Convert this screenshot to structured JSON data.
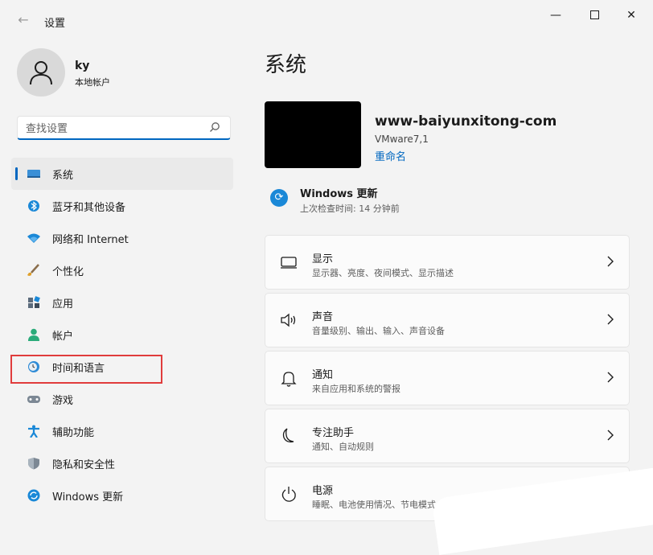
{
  "titlebar": {
    "app_title": "设置",
    "back_glyph": "←",
    "min_glyph": "—",
    "close_glyph": "✕"
  },
  "user": {
    "name": "ky",
    "account_type": "本地帐户"
  },
  "search": {
    "placeholder": "查找设置"
  },
  "sidebar": {
    "items": [
      {
        "label": "系统",
        "icon": "system-display-icon",
        "active": true
      },
      {
        "label": "蓝牙和其他设备",
        "icon": "bluetooth-icon"
      },
      {
        "label": "网络和 Internet",
        "icon": "wifi-icon"
      },
      {
        "label": "个性化",
        "icon": "brush-icon"
      },
      {
        "label": "应用",
        "icon": "apps-icon"
      },
      {
        "label": "帐户",
        "icon": "account-icon"
      },
      {
        "label": "时间和语言",
        "icon": "time-language-icon",
        "highlighted": true
      },
      {
        "label": "游戏",
        "icon": "gamepad-icon"
      },
      {
        "label": "辅助功能",
        "icon": "accessibility-icon"
      },
      {
        "label": "隐私和安全性",
        "icon": "shield-icon"
      },
      {
        "label": "Windows 更新",
        "icon": "windows-update-icon"
      }
    ]
  },
  "main": {
    "title": "系统",
    "device": {
      "name": "www-baiyunxitong-com",
      "model": "VMware7,1",
      "rename": "重命名"
    },
    "update": {
      "title": "Windows 更新",
      "subtitle": "上次检查时间: 14 分钟前"
    },
    "cards": [
      {
        "title": "显示",
        "subtitle": "显示器、亮度、夜间模式、显示描述",
        "icon": "monitor-icon"
      },
      {
        "title": "声音",
        "subtitle": "音量级别、输出、输入、声音设备",
        "icon": "speaker-icon"
      },
      {
        "title": "通知",
        "subtitle": "来自应用和系统的警报",
        "icon": "bell-icon"
      },
      {
        "title": "专注助手",
        "subtitle": "通知、自动规则",
        "icon": "moon-icon"
      },
      {
        "title": "电源",
        "subtitle": "睡眠、电池使用情况、节电模式",
        "icon": "power-icon"
      }
    ]
  },
  "colors": {
    "accent": "#0067c0",
    "highlight_box": "#e03c3c",
    "background": "#f3f3f3"
  }
}
